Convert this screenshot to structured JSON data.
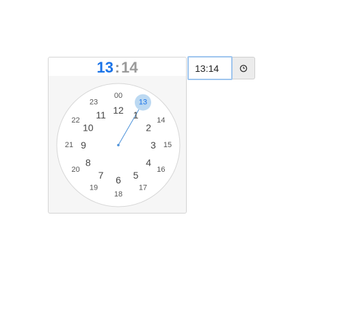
{
  "clock_picker": {
    "selected_hour": "13",
    "separator": ":",
    "selected_minute": "14",
    "active_view": "hours",
    "outer_ring_labels": [
      "00",
      "13",
      "14",
      "15",
      "16",
      "17",
      "18",
      "19",
      "20",
      "21",
      "22",
      "23"
    ],
    "inner_ring_labels": [
      "12",
      "1",
      "2",
      "3",
      "4",
      "5",
      "6",
      "7",
      "8",
      "9",
      "10",
      "11"
    ],
    "accent_color": "#1a73e8",
    "highlight_color": "#bcd9f2"
  },
  "time_input": {
    "value": "13:14"
  },
  "clock_button": {
    "icon": "clock-icon"
  }
}
